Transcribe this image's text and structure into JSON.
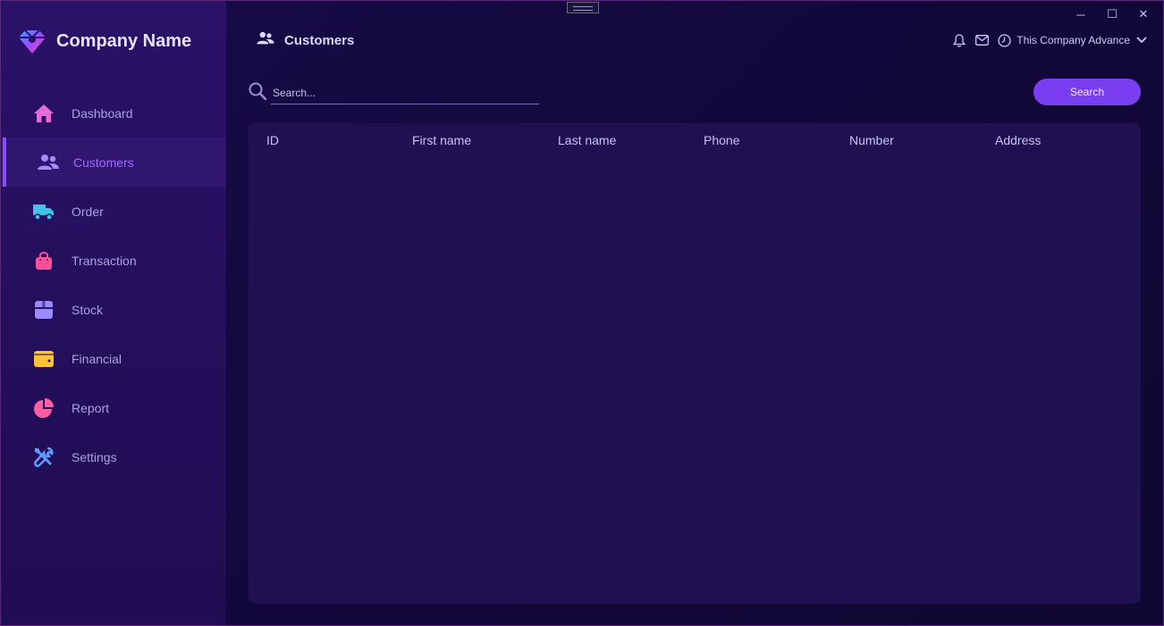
{
  "brand": {
    "name": "Company Name"
  },
  "sidebar": {
    "items": [
      {
        "label": "Dashboard",
        "icon": "home-icon",
        "color": "#e46bd8"
      },
      {
        "label": "Customers",
        "icon": "users-icon",
        "color": "#a68bff",
        "active": true
      },
      {
        "label": "Order",
        "icon": "truck-icon",
        "color": "#3fc3e8"
      },
      {
        "label": "Transaction",
        "icon": "shopping-bag-icon",
        "color": "#ff4f9a"
      },
      {
        "label": "Stock",
        "icon": "box-icon",
        "color": "#9a8cff"
      },
      {
        "label": "Financial",
        "icon": "wallet-icon",
        "color": "#ffc33a"
      },
      {
        "label": "Report",
        "icon": "pie-chart-icon",
        "color": "#ff5fa2"
      },
      {
        "label": "Settings",
        "icon": "tools-icon",
        "color": "#5e9bff"
      }
    ]
  },
  "header": {
    "title": "Customers",
    "icon": "users-icon"
  },
  "topbar": {
    "company": "This Company Advance",
    "icons": [
      "bell-icon",
      "mail-icon",
      "clock-icon",
      "chevron-down-icon"
    ]
  },
  "window_controls": {
    "minimize": "─",
    "maximize": "☐",
    "close": "✕"
  },
  "search": {
    "placeholder": "Search...",
    "value": "",
    "button_label": "Search"
  },
  "table": {
    "columns": [
      "ID",
      "First name",
      "Last name",
      "Phone",
      "Number",
      "Address"
    ],
    "rows": []
  },
  "colors": {
    "accent": "#7b3df0",
    "active_text": "#9f6bff",
    "sidebar_bg": "#2a1268",
    "panel_bg": "#1f1052",
    "window_bg": "#160b44"
  }
}
